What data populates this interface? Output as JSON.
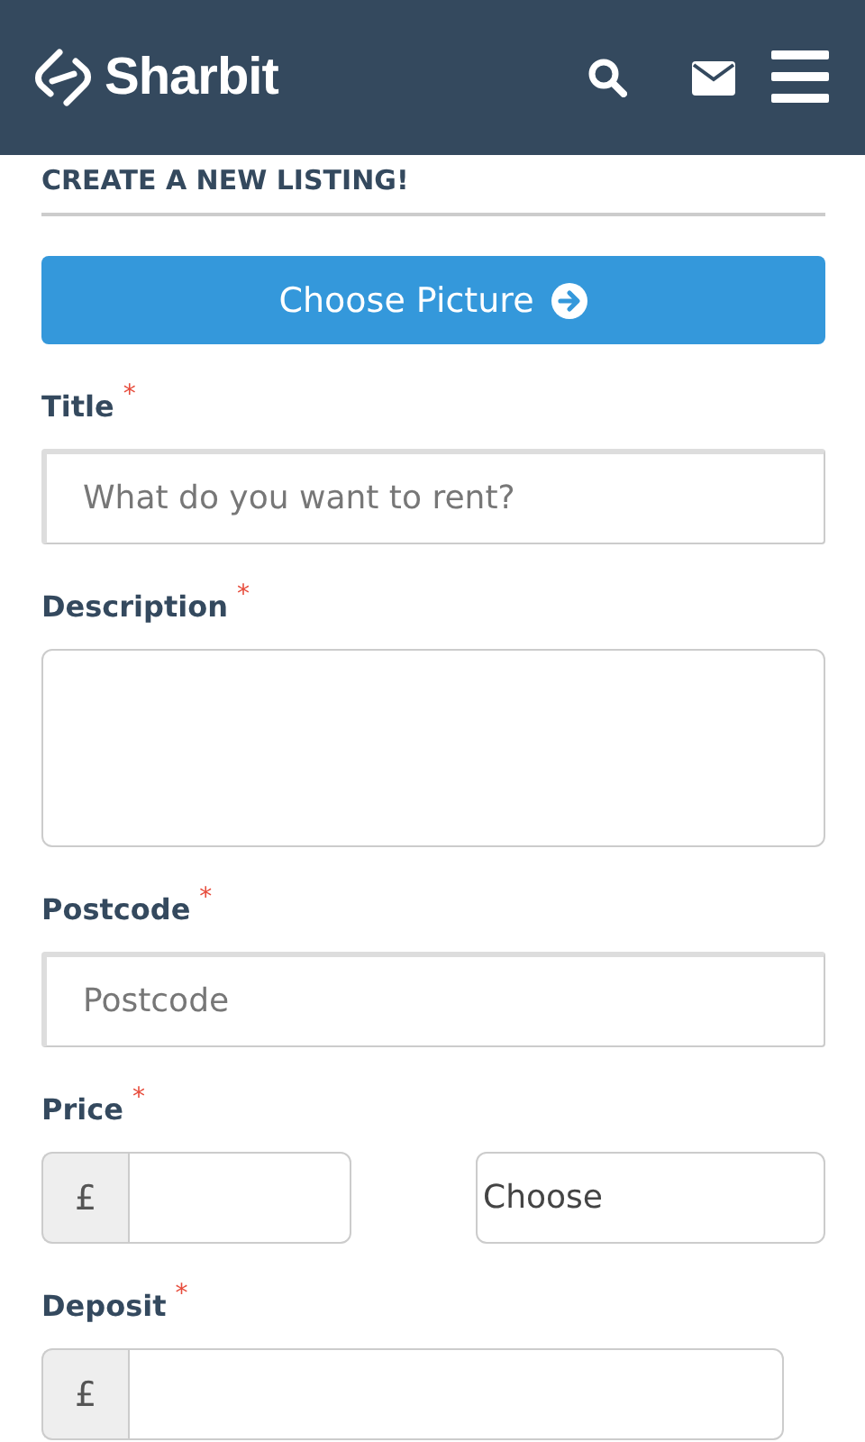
{
  "header": {
    "brand": "Sharbit"
  },
  "page": {
    "heading": "CREATE A NEW LISTING!",
    "choose_button": "Choose Picture"
  },
  "fields": [
    {
      "kind": "text",
      "label": "Title",
      "required_mark": "*",
      "placeholder": "What do you want to rent?"
    },
    {
      "kind": "textarea",
      "label": "Description",
      "required_mark": "*"
    },
    {
      "kind": "text",
      "label": "Postcode",
      "required_mark": "*",
      "placeholder": "Postcode"
    },
    {
      "kind": "price",
      "label": "Price",
      "required_mark": "*",
      "currency": "£",
      "select_value": "Choose"
    },
    {
      "kind": "wide_price",
      "label": "Deposit",
      "required_mark": "*",
      "currency": "£"
    }
  ]
}
